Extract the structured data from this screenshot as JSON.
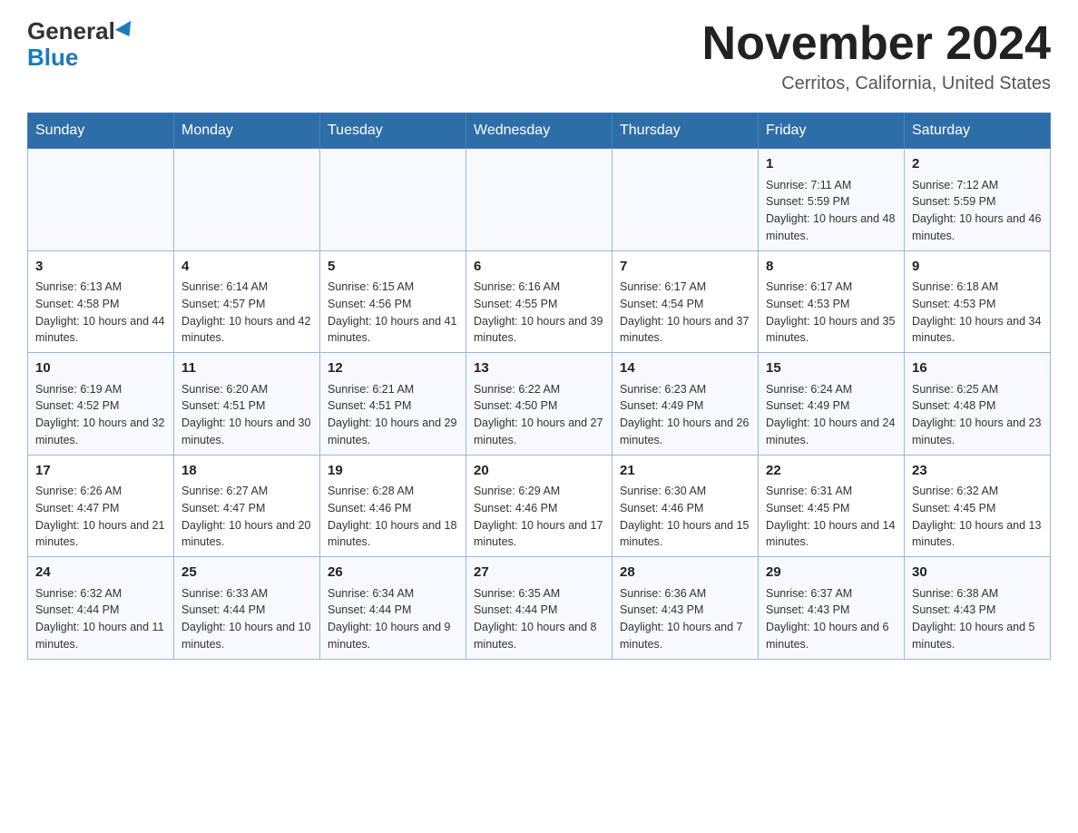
{
  "header": {
    "logo_general": "General",
    "logo_blue": "Blue",
    "month_title": "November 2024",
    "location": "Cerritos, California, United States"
  },
  "days_of_week": [
    "Sunday",
    "Monday",
    "Tuesday",
    "Wednesday",
    "Thursday",
    "Friday",
    "Saturday"
  ],
  "weeks": [
    [
      {
        "day": "",
        "info": ""
      },
      {
        "day": "",
        "info": ""
      },
      {
        "day": "",
        "info": ""
      },
      {
        "day": "",
        "info": ""
      },
      {
        "day": "",
        "info": ""
      },
      {
        "day": "1",
        "info": "Sunrise: 7:11 AM\nSunset: 5:59 PM\nDaylight: 10 hours and 48 minutes."
      },
      {
        "day": "2",
        "info": "Sunrise: 7:12 AM\nSunset: 5:59 PM\nDaylight: 10 hours and 46 minutes."
      }
    ],
    [
      {
        "day": "3",
        "info": "Sunrise: 6:13 AM\nSunset: 4:58 PM\nDaylight: 10 hours and 44 minutes."
      },
      {
        "day": "4",
        "info": "Sunrise: 6:14 AM\nSunset: 4:57 PM\nDaylight: 10 hours and 42 minutes."
      },
      {
        "day": "5",
        "info": "Sunrise: 6:15 AM\nSunset: 4:56 PM\nDaylight: 10 hours and 41 minutes."
      },
      {
        "day": "6",
        "info": "Sunrise: 6:16 AM\nSunset: 4:55 PM\nDaylight: 10 hours and 39 minutes."
      },
      {
        "day": "7",
        "info": "Sunrise: 6:17 AM\nSunset: 4:54 PM\nDaylight: 10 hours and 37 minutes."
      },
      {
        "day": "8",
        "info": "Sunrise: 6:17 AM\nSunset: 4:53 PM\nDaylight: 10 hours and 35 minutes."
      },
      {
        "day": "9",
        "info": "Sunrise: 6:18 AM\nSunset: 4:53 PM\nDaylight: 10 hours and 34 minutes."
      }
    ],
    [
      {
        "day": "10",
        "info": "Sunrise: 6:19 AM\nSunset: 4:52 PM\nDaylight: 10 hours and 32 minutes."
      },
      {
        "day": "11",
        "info": "Sunrise: 6:20 AM\nSunset: 4:51 PM\nDaylight: 10 hours and 30 minutes."
      },
      {
        "day": "12",
        "info": "Sunrise: 6:21 AM\nSunset: 4:51 PM\nDaylight: 10 hours and 29 minutes."
      },
      {
        "day": "13",
        "info": "Sunrise: 6:22 AM\nSunset: 4:50 PM\nDaylight: 10 hours and 27 minutes."
      },
      {
        "day": "14",
        "info": "Sunrise: 6:23 AM\nSunset: 4:49 PM\nDaylight: 10 hours and 26 minutes."
      },
      {
        "day": "15",
        "info": "Sunrise: 6:24 AM\nSunset: 4:49 PM\nDaylight: 10 hours and 24 minutes."
      },
      {
        "day": "16",
        "info": "Sunrise: 6:25 AM\nSunset: 4:48 PM\nDaylight: 10 hours and 23 minutes."
      }
    ],
    [
      {
        "day": "17",
        "info": "Sunrise: 6:26 AM\nSunset: 4:47 PM\nDaylight: 10 hours and 21 minutes."
      },
      {
        "day": "18",
        "info": "Sunrise: 6:27 AM\nSunset: 4:47 PM\nDaylight: 10 hours and 20 minutes."
      },
      {
        "day": "19",
        "info": "Sunrise: 6:28 AM\nSunset: 4:46 PM\nDaylight: 10 hours and 18 minutes."
      },
      {
        "day": "20",
        "info": "Sunrise: 6:29 AM\nSunset: 4:46 PM\nDaylight: 10 hours and 17 minutes."
      },
      {
        "day": "21",
        "info": "Sunrise: 6:30 AM\nSunset: 4:46 PM\nDaylight: 10 hours and 15 minutes."
      },
      {
        "day": "22",
        "info": "Sunrise: 6:31 AM\nSunset: 4:45 PM\nDaylight: 10 hours and 14 minutes."
      },
      {
        "day": "23",
        "info": "Sunrise: 6:32 AM\nSunset: 4:45 PM\nDaylight: 10 hours and 13 minutes."
      }
    ],
    [
      {
        "day": "24",
        "info": "Sunrise: 6:32 AM\nSunset: 4:44 PM\nDaylight: 10 hours and 11 minutes."
      },
      {
        "day": "25",
        "info": "Sunrise: 6:33 AM\nSunset: 4:44 PM\nDaylight: 10 hours and 10 minutes."
      },
      {
        "day": "26",
        "info": "Sunrise: 6:34 AM\nSunset: 4:44 PM\nDaylight: 10 hours and 9 minutes."
      },
      {
        "day": "27",
        "info": "Sunrise: 6:35 AM\nSunset: 4:44 PM\nDaylight: 10 hours and 8 minutes."
      },
      {
        "day": "28",
        "info": "Sunrise: 6:36 AM\nSunset: 4:43 PM\nDaylight: 10 hours and 7 minutes."
      },
      {
        "day": "29",
        "info": "Sunrise: 6:37 AM\nSunset: 4:43 PM\nDaylight: 10 hours and 6 minutes."
      },
      {
        "day": "30",
        "info": "Sunrise: 6:38 AM\nSunset: 4:43 PM\nDaylight: 10 hours and 5 minutes."
      }
    ]
  ]
}
